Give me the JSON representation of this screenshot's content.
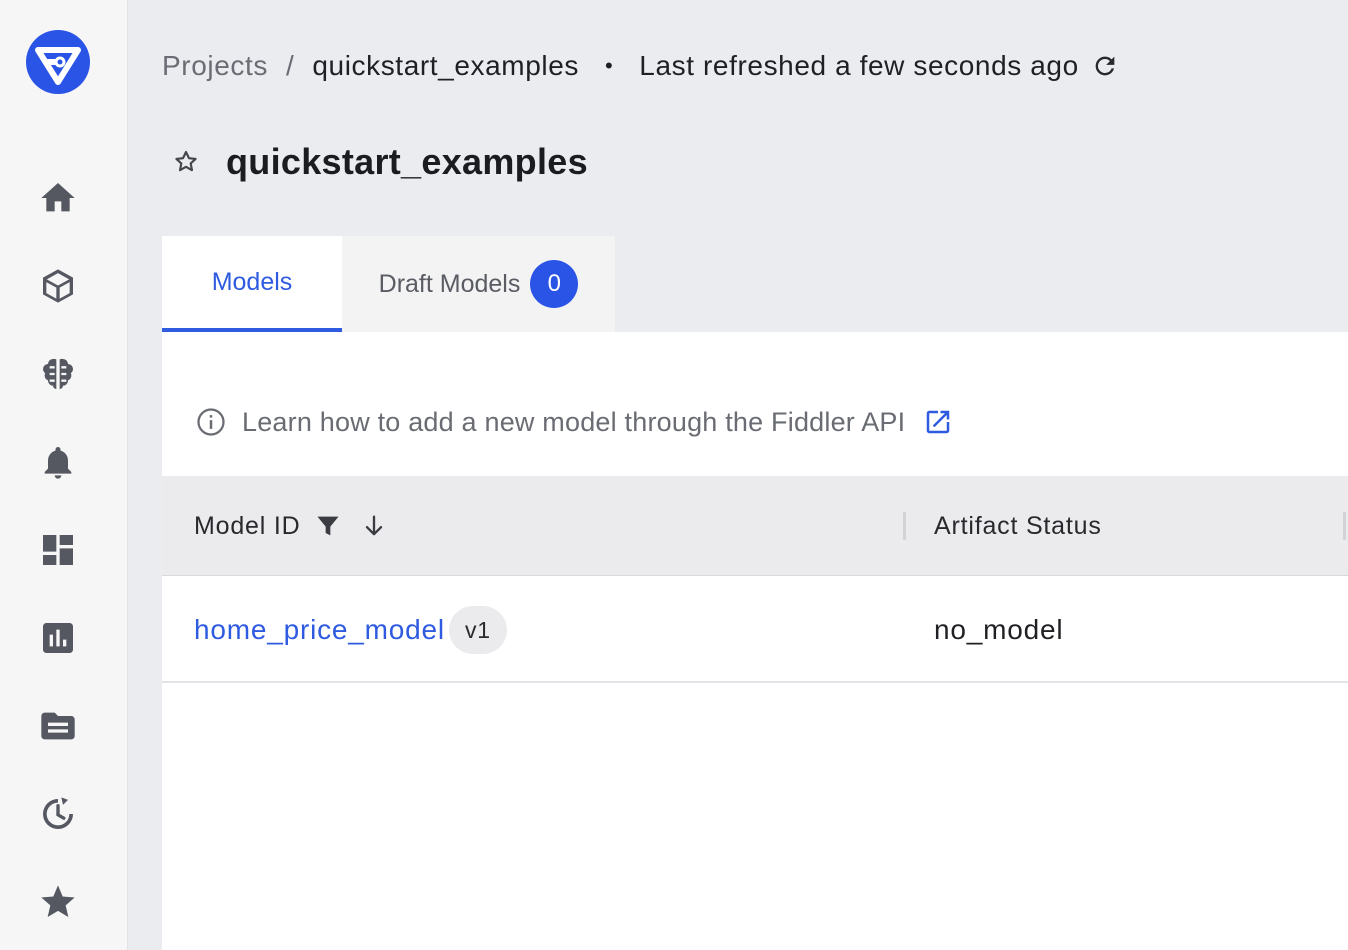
{
  "breadcrumb": {
    "projects": "Projects",
    "separator": "/",
    "current": "quickstart_examples",
    "dot": "•",
    "refreshed": "Last refreshed a few seconds ago"
  },
  "page": {
    "title": "quickstart_examples"
  },
  "tabs": {
    "models": "Models",
    "draft_models": "Draft Models",
    "draft_count": "0"
  },
  "info": {
    "text": "Learn how to add a new model through the Fiddler API"
  },
  "table": {
    "columns": [
      "Model ID",
      "Artifact Status"
    ],
    "rows": [
      {
        "model_id": "home_price_model",
        "version": "v1",
        "artifact_status": "no_model"
      }
    ]
  },
  "colors": {
    "accent": "#2f5be0",
    "badge": "#2a54e6",
    "nav_icon": "#555860"
  },
  "sidebar": {
    "icons": [
      "home-icon",
      "cube-icon",
      "brain-icon",
      "bell-icon",
      "dashboard-icon",
      "chart-icon",
      "folder-icon",
      "history-icon",
      "star-icon"
    ]
  }
}
